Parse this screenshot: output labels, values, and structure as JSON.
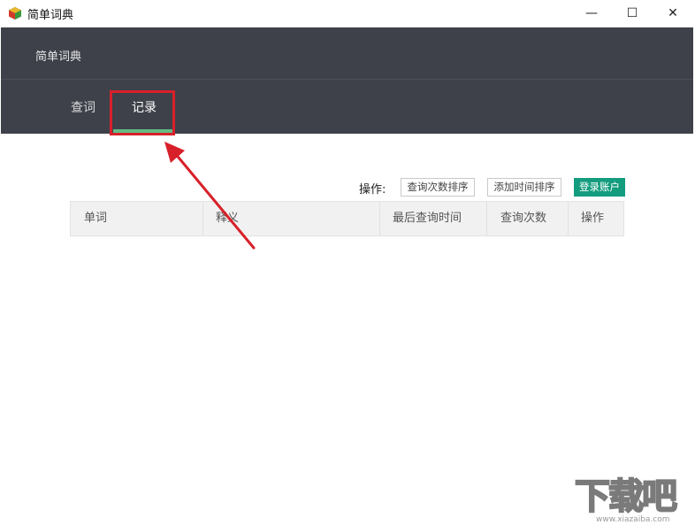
{
  "window": {
    "title": "简单词典",
    "controls": {
      "minimize": "—",
      "maximize": "☐",
      "close": "✕"
    }
  },
  "header": {
    "title": "简单词典",
    "tabs": [
      {
        "label": "查词",
        "active": false
      },
      {
        "label": "记录",
        "active": true
      }
    ]
  },
  "toolbar": {
    "label": "操作:",
    "sort_by_count": "查询次数排序",
    "sort_by_time": "添加时间排序",
    "login": "登录账户"
  },
  "table": {
    "columns": [
      "单词",
      "释义",
      "最后查询时间",
      "查询次数",
      "操作"
    ],
    "rows": []
  },
  "watermark": {
    "text": "下载吧",
    "url": "www.xiazaiba.com"
  },
  "colors": {
    "header_bg": "#3e4149",
    "tab_underline": "#65bb85",
    "login_button": "#149c7e",
    "annotation": "#d8202a"
  }
}
